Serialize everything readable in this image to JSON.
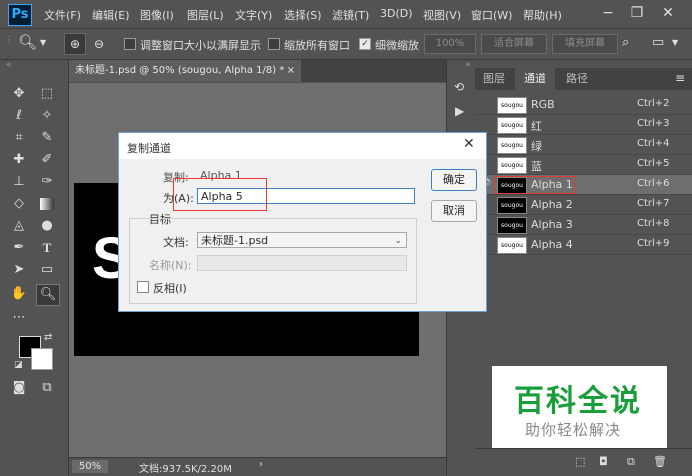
{
  "app": {
    "logo": "Ps"
  },
  "menu": [
    "文件(F)",
    "编辑(E)",
    "图像(I)",
    "图层(L)",
    "文字(Y)",
    "选择(S)",
    "滤镜(T)",
    "3D(D)",
    "视图(V)",
    "窗口(W)",
    "帮助(H)"
  ],
  "window_controls": {
    "minimize": "−",
    "restore": "❐",
    "close": "✕"
  },
  "options": {
    "fit_window": "调整窗口大小以满屏显示",
    "zoom_all": "缩放所有窗口",
    "scrubby_zoom": "细微缩放",
    "percent_btn": "100%",
    "fit_screen_btn": "适合屏幕",
    "fill_screen_btn": "填充屏幕"
  },
  "document": {
    "tab_title": "未标题-1.psd @ 50% (sougou, Alpha 1/8) *",
    "canvas_letter": "S",
    "status_zoom": "50%",
    "status_doc": "文档:937.5K/2.20M"
  },
  "panel": {
    "tabs": [
      "图层",
      "通道",
      "路径"
    ],
    "channels": [
      {
        "thumb": "sougou",
        "name": "RGB",
        "key": "Ctrl+2",
        "thumb_dark": false
      },
      {
        "thumb": "sougou",
        "name": "红",
        "key": "Ctrl+3",
        "thumb_dark": false
      },
      {
        "thumb": "sougou",
        "name": "绿",
        "key": "Ctrl+4",
        "thumb_dark": false
      },
      {
        "thumb": "sougou",
        "name": "蓝",
        "key": "Ctrl+5",
        "thumb_dark": false
      },
      {
        "thumb": "sougou",
        "name": "Alpha 1",
        "key": "Ctrl+6",
        "thumb_dark": true
      },
      {
        "thumb": "sougou",
        "name": "Alpha 2",
        "key": "Ctrl+7",
        "thumb_dark": true
      },
      {
        "thumb": "sougou",
        "name": "Alpha 3",
        "key": "Ctrl+8",
        "thumb_dark": true
      },
      {
        "thumb": "sougou",
        "name": "Alpha 4",
        "key": "Ctrl+9",
        "thumb_dark": false
      }
    ]
  },
  "dialog": {
    "title": "复制通道",
    "copy_label": "复制:",
    "copy_value": "Alpha 1",
    "as_label": "为(A):",
    "as_value": "Alpha 5",
    "target_legend": "目标",
    "doc_label": "文档:",
    "doc_value": "未标题-1.psd",
    "name_label": "名称(N):",
    "invert_label": "反相(I)",
    "ok": "确定",
    "cancel": "取消"
  },
  "watermark": {
    "title": "百科全说",
    "subtitle": "助你轻松解决"
  },
  "colors": {
    "accent_highlight": "#e53935",
    "watermark_green": "#1a9e3c",
    "panel_bg": "#535353",
    "canvas_bg": "#6f6f6f"
  }
}
